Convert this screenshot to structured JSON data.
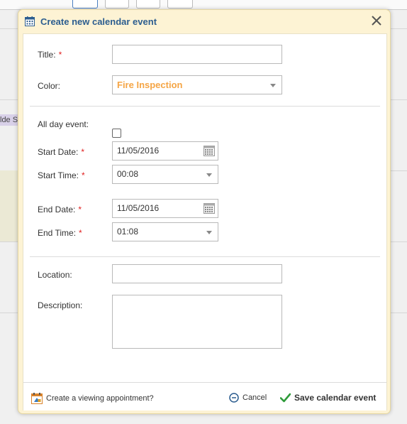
{
  "background": {
    "tag_text": "lde S"
  },
  "dialog": {
    "title": "Create new calendar event",
    "form": {
      "title_label": "Title:",
      "title_value": "",
      "color_label": "Color:",
      "color_value": "Fire Inspection",
      "all_day_label": "All day event:",
      "all_day_checked": false,
      "start_date_label": "Start Date:",
      "start_date_value": "11/05/2016",
      "start_time_label": "Start Time:",
      "start_time_value": "00:08",
      "end_date_label": "End Date:",
      "end_date_value": "11/05/2016",
      "end_time_label": "End Time:",
      "end_time_value": "01:08",
      "location_label": "Location:",
      "location_value": "",
      "description_label": "Description:",
      "description_value": "",
      "required_marker": "*"
    },
    "footer": {
      "viewing_link": "Create a viewing appointment?",
      "cancel_label": "Cancel",
      "save_label": "Save calendar event"
    }
  },
  "colors": {
    "title_text": "#2c5d8f",
    "color_value_text": "#f5a545",
    "required": "#e01e1e",
    "dialog_frame": "#fdf3d4",
    "save_check": "#2e9b3a"
  }
}
